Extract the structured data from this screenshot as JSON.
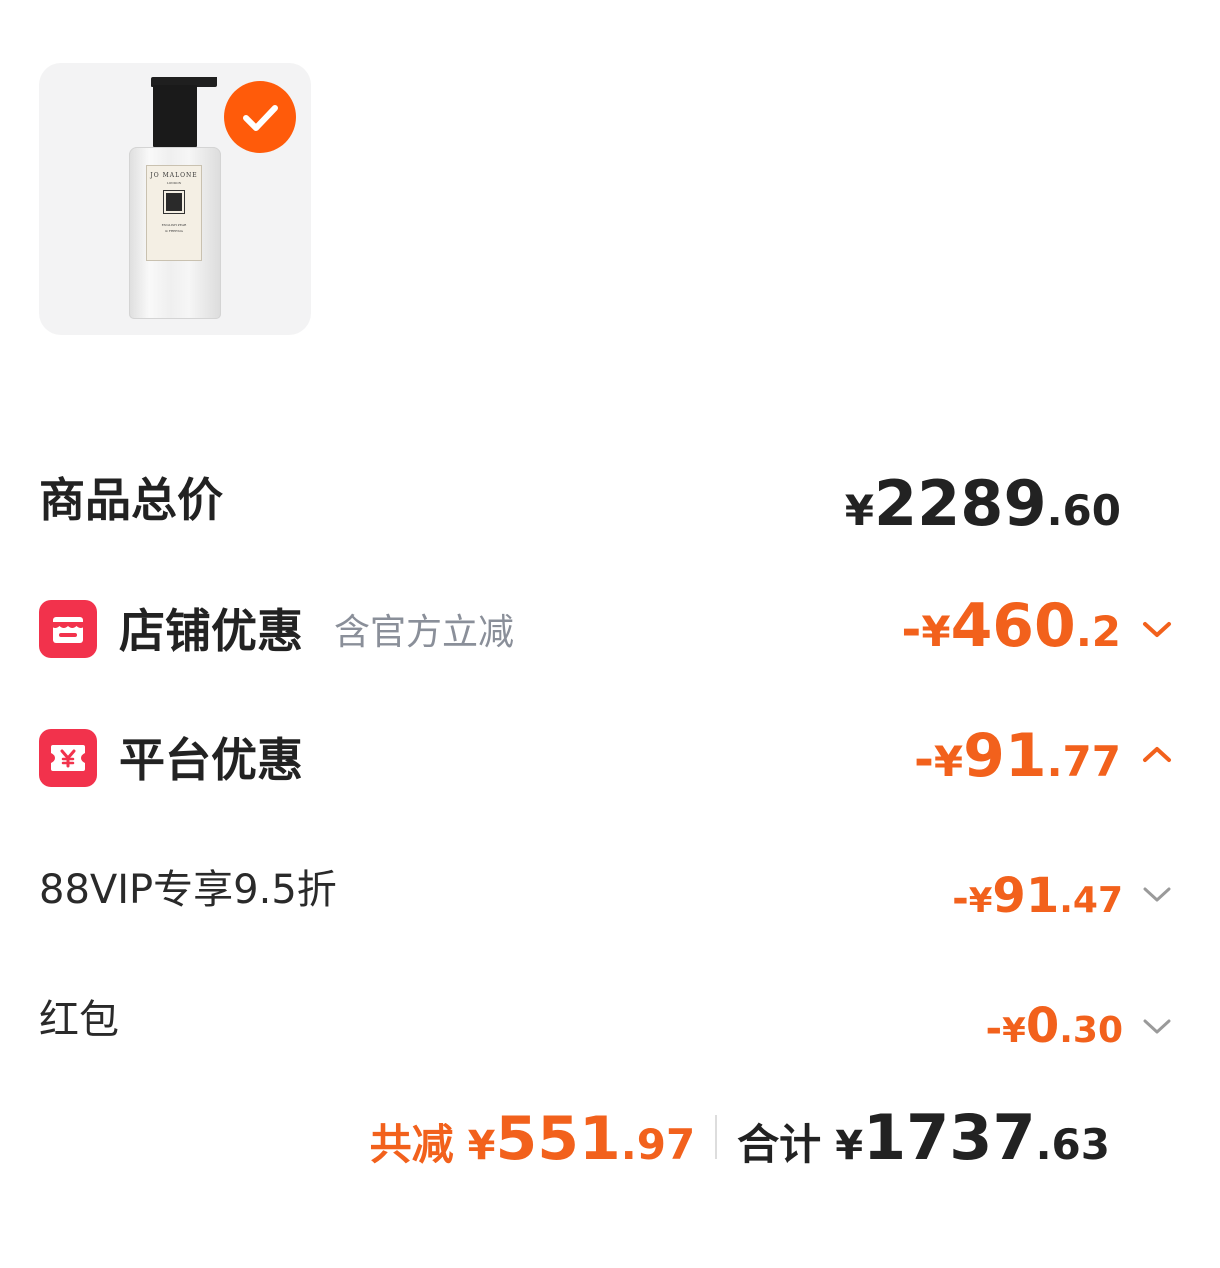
{
  "product": {
    "image_icon": "product-bottle-image",
    "bottle_brand": "JO MALONE",
    "bottle_sub": "LONDON",
    "bottle_line1": "ENGLISH PEAR",
    "bottle_line2": "& FREESIA",
    "selected": true,
    "check_color": "#ff5b0a"
  },
  "total": {
    "label": "商品总价",
    "yen": "¥",
    "integer": "2289",
    "decimal": ".60"
  },
  "shop_discount": {
    "icon": "shop-icon",
    "label": "店铺优惠",
    "note": "含官方立减",
    "sign": "-",
    "yen": "¥",
    "integer": "460",
    "decimal": ".2",
    "chevron": "chevron-down-icon"
  },
  "platform_discount": {
    "icon": "yen-coupon-icon",
    "label": "平台优惠",
    "sign": "-",
    "yen": "¥",
    "integer": "91",
    "decimal": ".77",
    "chevron": "chevron-up-icon"
  },
  "vip_discount": {
    "label": "88VIP专享9.5折",
    "sign": "-",
    "yen": "¥",
    "integer": "91",
    "decimal": ".47",
    "chevron": "chevron-down-icon"
  },
  "red_packet": {
    "label": "红包",
    "sign": "-",
    "yen": "¥",
    "integer": "0",
    "decimal": ".30",
    "chevron": "chevron-down-icon"
  },
  "summary": {
    "saved_label": "共减",
    "saved_yen": "¥",
    "saved_integer": "551",
    "saved_decimal": ".97",
    "sum_label": "合计",
    "sum_yen": "¥",
    "sum_integer": "1737",
    "sum_decimal": ".63"
  },
  "colors": {
    "accent_orange": "#f2611c",
    "icon_red": "#f2324c",
    "note_gray": "#8a8f99"
  }
}
